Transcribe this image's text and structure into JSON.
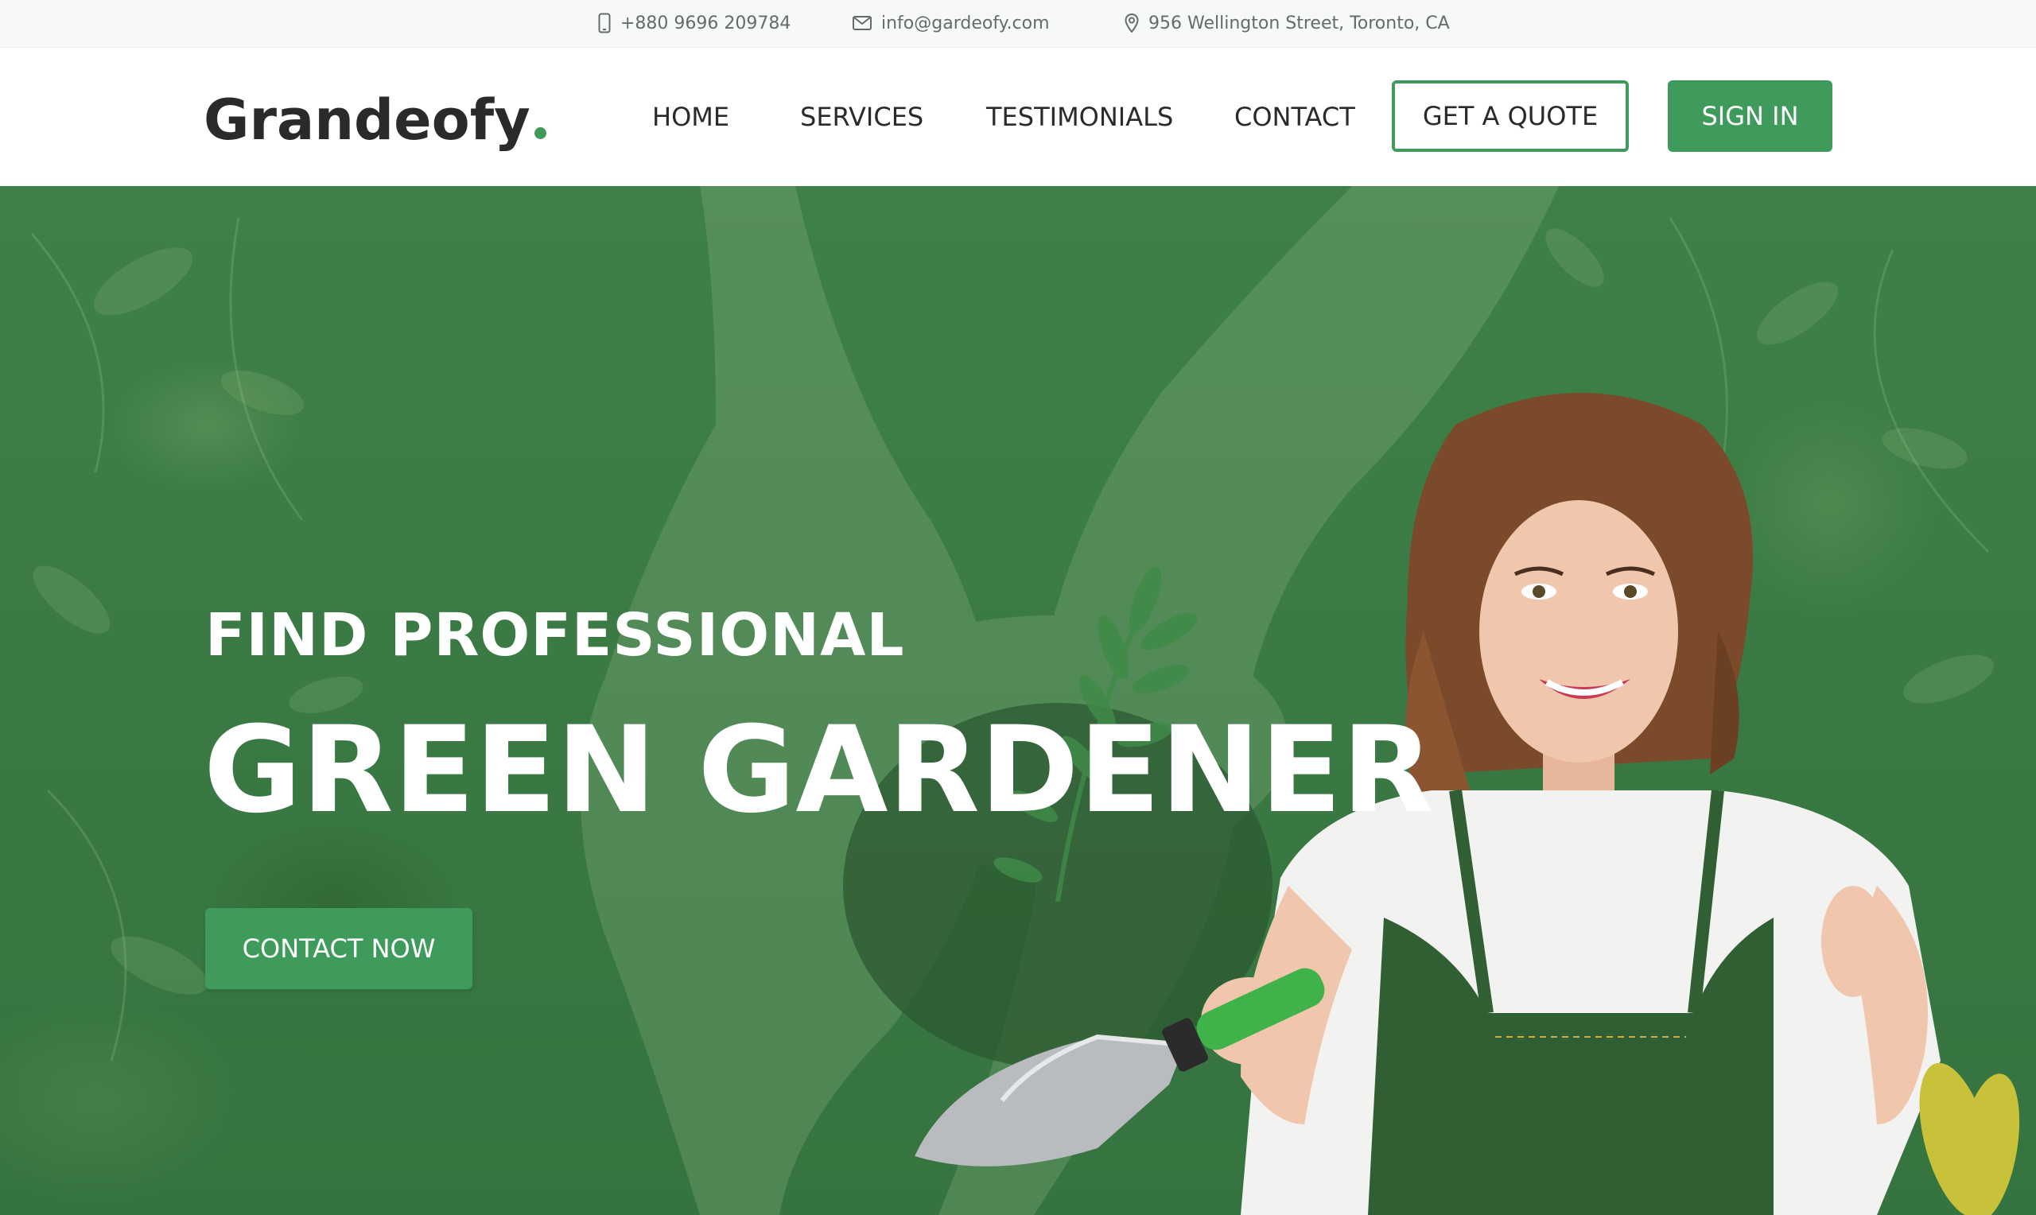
{
  "topbar": {
    "phone": {
      "icon": "mobile-phone-icon",
      "text": "+880 9696 209784"
    },
    "email": {
      "icon": "envelope-icon",
      "text": "info@gardeofy.com"
    },
    "address": {
      "icon": "map-pin-icon",
      "text": "956 Wellington Street, Toronto, CA"
    }
  },
  "header": {
    "logo_text": "Grandeofy",
    "nav": {
      "home": "HOME",
      "services": "SERVICES",
      "testimonials": "TESTIMONIALS",
      "contact": "CONTACT"
    },
    "quote_button": "GET A QUOTE",
    "signin_button": "SIGN IN"
  },
  "hero": {
    "subtitle": "FIND PROFESSIONAL",
    "title": "GREEN GARDENER",
    "cta_button": "CONTACT NOW"
  },
  "colors": {
    "accent": "#3f9b5c",
    "hero_overlay": "#3b7a44",
    "text_dark": "#2a2a2a",
    "topbar_text": "#666b68"
  }
}
